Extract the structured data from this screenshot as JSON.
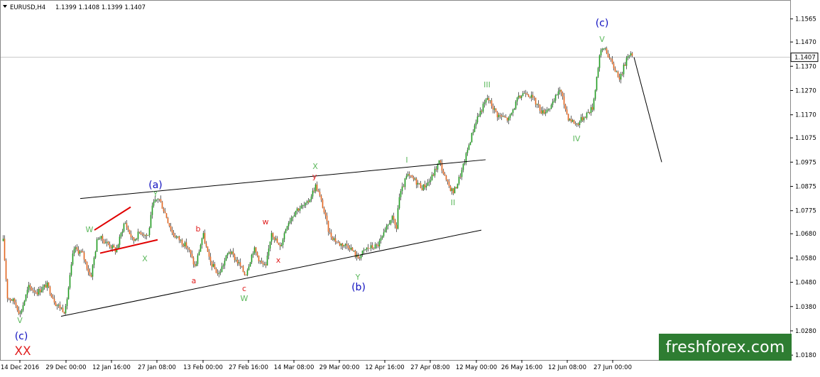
{
  "header": {
    "symbol": "EURUSD,H4",
    "ohlc": "1.1399 1.1408 1.1399 1.1407"
  },
  "watermark": "freshforex.com",
  "colors": {
    "bull": "#1f9a1f",
    "bear": "#e2651f",
    "wick": "#222222",
    "grid": "#c8c8c8",
    "channel": "#000000",
    "triangle": "#e00000",
    "label_red": "#e02020",
    "label_green": "#5cb85c",
    "label_blue": "#1010c0",
    "price_box_bg": "#ffffff",
    "watermark_bg": "#2e7d32",
    "watermark_fg": "#ffffff"
  },
  "chart_data": {
    "type": "candlestick",
    "title": "",
    "x_tick_labels": [
      "14 Dec 2016",
      "29 Dec 00:00",
      "12 Jan 16:00",
      "27 Jan 08:00",
      "13 Feb 00:00",
      "27 Feb 16:00",
      "14 Mar 08:00",
      "29 Mar 00:00",
      "12 Apr 16:00",
      "27 Apr 08:00",
      "12 May 00:00",
      "26 May 16:00",
      "12 Jun 08:00",
      "27 Jun 00:00"
    ],
    "y_tick_labels": [
      "1.1565",
      "1.1470",
      "1.1370",
      "1.1270",
      "1.1170",
      "1.1075",
      "1.0975",
      "1.0875",
      "1.0775",
      "1.0680",
      "1.0580",
      "1.0480",
      "1.0380",
      "1.0280",
      "1.0180"
    ],
    "ylim": [
      1.016,
      1.164
    ],
    "current_price": "1.1407",
    "series": [
      {
        "name": "EURUSD H4 (approx. path)",
        "path": [
          [
            0,
            1.065
          ],
          [
            6,
            1.042
          ],
          [
            16,
            1.04
          ],
          [
            24,
            1.035
          ],
          [
            36,
            1.046
          ],
          [
            48,
            1.044
          ],
          [
            62,
            1.047
          ],
          [
            75,
            1.039
          ],
          [
            88,
            1.036
          ],
          [
            100,
            1.062
          ],
          [
            112,
            1.06
          ],
          [
            124,
            1.05
          ],
          [
            134,
            1.067
          ],
          [
            148,
            1.064
          ],
          [
            160,
            1.061
          ],
          [
            172,
            1.073
          ],
          [
            184,
            1.065
          ],
          [
            194,
            1.069
          ],
          [
            205,
            1.067
          ],
          [
            212,
            1.08
          ],
          [
            220,
            1.083
          ],
          [
            230,
            1.076
          ],
          [
            240,
            1.068
          ],
          [
            252,
            1.065
          ],
          [
            262,
            1.062
          ],
          [
            272,
            1.054
          ],
          [
            283,
            1.068
          ],
          [
            292,
            1.057
          ],
          [
            305,
            1.051
          ],
          [
            320,
            1.061
          ],
          [
            333,
            1.056
          ],
          [
            343,
            1.051
          ],
          [
            355,
            1.062
          ],
          [
            365,
            1.056
          ],
          [
            372,
            1.054
          ],
          [
            380,
            1.069
          ],
          [
            392,
            1.062
          ],
          [
            402,
            1.072
          ],
          [
            415,
            1.078
          ],
          [
            430,
            1.08
          ],
          [
            443,
            1.088
          ],
          [
            452,
            1.08
          ],
          [
            462,
            1.068
          ],
          [
            475,
            1.064
          ],
          [
            490,
            1.063
          ],
          [
            502,
            1.058
          ],
          [
            515,
            1.062
          ],
          [
            530,
            1.063
          ],
          [
            540,
            1.068
          ],
          [
            550,
            1.075
          ],
          [
            557,
            1.07
          ],
          [
            560,
            1.082
          ],
          [
            572,
            1.092
          ],
          [
            583,
            1.09
          ],
          [
            594,
            1.087
          ],
          [
            605,
            1.09
          ],
          [
            618,
            1.098
          ],
          [
            628,
            1.089
          ],
          [
            638,
            1.085
          ],
          [
            650,
            1.094
          ],
          [
            660,
            1.105
          ],
          [
            670,
            1.115
          ],
          [
            686,
            1.124
          ],
          [
            700,
            1.117
          ],
          [
            716,
            1.115
          ],
          [
            728,
            1.123
          ],
          [
            740,
            1.127
          ],
          [
            752,
            1.123
          ],
          [
            764,
            1.118
          ],
          [
            778,
            1.121
          ],
          [
            788,
            1.128
          ],
          [
            800,
            1.116
          ],
          [
            812,
            1.113
          ],
          [
            825,
            1.117
          ],
          [
            835,
            1.12
          ],
          [
            845,
            1.142
          ],
          [
            852,
            1.145
          ],
          [
            862,
            1.138
          ],
          [
            874,
            1.132
          ],
          [
            886,
            1.143
          ],
          [
            891,
            1.1407
          ]
        ]
      }
    ],
    "annotations": {
      "wave_labels": [
        {
          "text": "(c)",
          "color": "blue",
          "size": "big"
        },
        {
          "text": "XX",
          "color": "red",
          "size": "xx"
        },
        {
          "text": "V",
          "color": "green"
        },
        {
          "text": "W",
          "color": "green"
        },
        {
          "text": "X",
          "color": "green"
        },
        {
          "text": "(a)",
          "color": "blue",
          "size": "big"
        },
        {
          "text": "Y",
          "color": "green"
        },
        {
          "text": "a",
          "color": "red"
        },
        {
          "text": "b",
          "color": "red"
        },
        {
          "text": "c",
          "color": "red"
        },
        {
          "text": "W",
          "color": "green"
        },
        {
          "text": "w",
          "color": "red"
        },
        {
          "text": "x",
          "color": "red"
        },
        {
          "text": "X",
          "color": "green"
        },
        {
          "text": "y",
          "color": "red"
        },
        {
          "text": "Y",
          "color": "green"
        },
        {
          "text": "(b)",
          "color": "blue",
          "size": "big"
        },
        {
          "text": "I",
          "color": "green"
        },
        {
          "text": "II",
          "color": "green"
        },
        {
          "text": "III",
          "color": "green"
        },
        {
          "text": "IV",
          "color": "green"
        },
        {
          "text": "V",
          "color": "green"
        },
        {
          "text": "(c)",
          "color": "blue",
          "size": "big"
        }
      ]
    }
  }
}
